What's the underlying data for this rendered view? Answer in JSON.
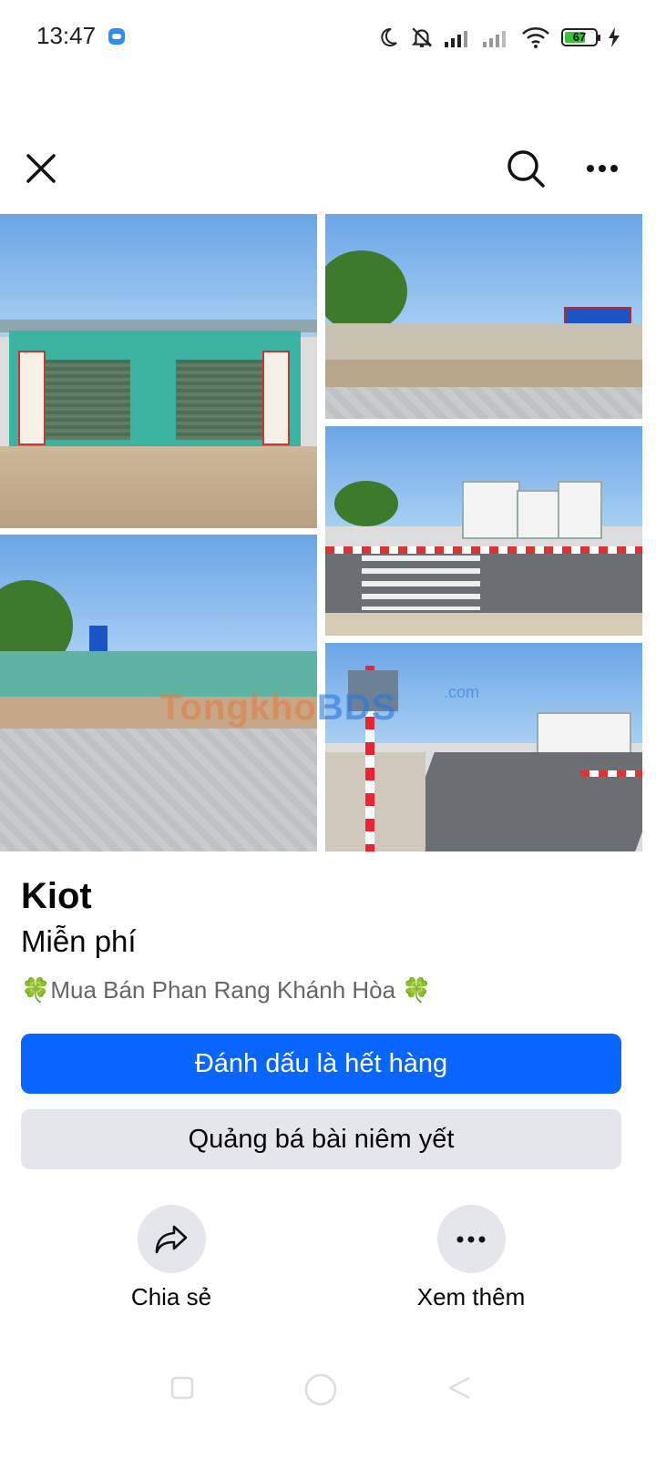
{
  "status_bar": {
    "time": "13:47",
    "battery": "67"
  },
  "top_bar": {
    "close_icon": "close-icon",
    "search_icon": "search-icon",
    "more_icon": "more-horizontal-icon"
  },
  "watermark": {
    "part1": "Tongkho",
    "part2": "BDS",
    "suffix": ".com"
  },
  "listing": {
    "title": "Kiot",
    "price": "Miễn phí",
    "group": "🍀Mua Bán Phan Rang Khánh Hòa 🍀"
  },
  "buttons": {
    "mark_sold": "Đánh dấu là hết hàng",
    "boost": "Quảng bá bài niêm yết"
  },
  "actions": {
    "share": "Chia sẻ",
    "more": "Xem thêm"
  },
  "colors": {
    "primary": "#0866ff",
    "secondary": "#e4e6eb"
  }
}
